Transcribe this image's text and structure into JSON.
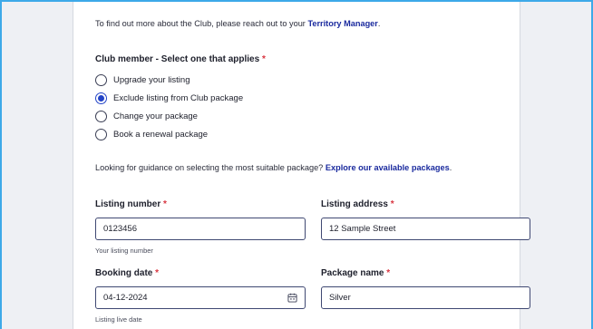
{
  "intro": {
    "text": "To find out more about the Club, please reach out to your ",
    "link": "Territory Manager",
    "suffix": "."
  },
  "club_question": {
    "label": "Club member - Select one that applies",
    "required_mark": "*",
    "options": [
      {
        "label": "Upgrade your listing",
        "checked": false
      },
      {
        "label": "Exclude listing from Club package",
        "checked": true
      },
      {
        "label": "Change your package",
        "checked": false
      },
      {
        "label": "Book a renewal package",
        "checked": false
      }
    ]
  },
  "guidance": {
    "text": "Looking for guidance on selecting the most suitable package? ",
    "link": "Explore our available packages",
    "suffix": "."
  },
  "fields": {
    "listing_number": {
      "label": "Listing number",
      "value": "0123456",
      "hint": "Your listing number"
    },
    "listing_address": {
      "label": "Listing address",
      "value": "12 Sample Street"
    },
    "booking_date": {
      "label": "Booking date",
      "value": "04-12-2024",
      "hint": "Listing live date"
    },
    "package_name": {
      "label": "Package name",
      "value": "Silver"
    }
  },
  "colors": {
    "accent": "#2344c7",
    "link": "#1a2a9e",
    "required": "#d8343f",
    "frame": "#3da9e8"
  }
}
